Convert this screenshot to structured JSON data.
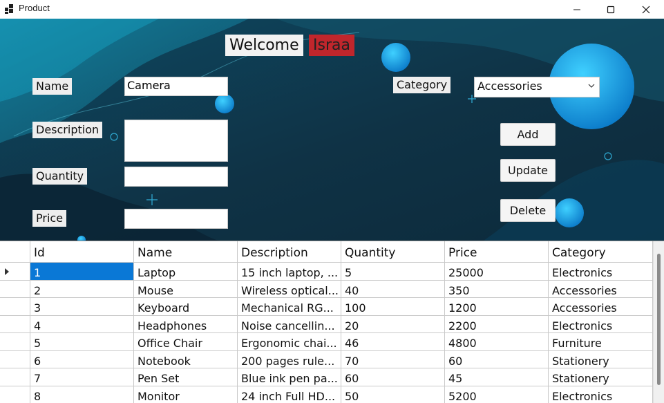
{
  "window": {
    "title": "Product",
    "minimize_icon": "minimize-icon",
    "maximize_icon": "maximize-icon",
    "close_icon": "close-icon"
  },
  "header": {
    "welcome": "Welcome",
    "user": "Israa"
  },
  "form": {
    "name_label": "Name",
    "name_value": "Camera",
    "description_label": "Description",
    "description_value": "",
    "quantity_label": "Quantity",
    "quantity_value": "",
    "price_label": "Price",
    "price_value": "",
    "category_label": "Category",
    "category_value": "Accessories"
  },
  "buttons": {
    "add": "Add",
    "update": "Update",
    "delete": "Delete"
  },
  "grid": {
    "columns": [
      "Id",
      "Name",
      "Description",
      "Quantity",
      "Price",
      "Category"
    ],
    "rows": [
      [
        "1",
        "Laptop",
        "15 inch laptop, ...",
        "5",
        "25000",
        "Electronics"
      ],
      [
        "2",
        "Mouse",
        "Wireless optical...",
        "40",
        "350",
        "Accessories"
      ],
      [
        "3",
        "Keyboard",
        "Mechanical RG...",
        "100",
        "1200",
        "Accessories"
      ],
      [
        "4",
        "Headphones",
        "Noise cancellin...",
        "20",
        "2200",
        "Electronics"
      ],
      [
        "5",
        "Office Chair",
        "Ergonomic chai...",
        "46",
        "4800",
        "Furniture"
      ],
      [
        "6",
        "Notebook",
        "200 pages rule...",
        "70",
        "60",
        "Stationery"
      ],
      [
        "7",
        "Pen Set",
        "Blue ink pen pa...",
        "60",
        "45",
        "Stationery"
      ],
      [
        "8",
        "Monitor",
        "24 inch Full HD...",
        "50",
        "5200",
        "Electronics"
      ]
    ]
  },
  "colors": {
    "form_background": "#0f3347",
    "accent_blue": "#1ba3e8",
    "user_badge": "#c0262c",
    "selection": "#0a78d6"
  }
}
